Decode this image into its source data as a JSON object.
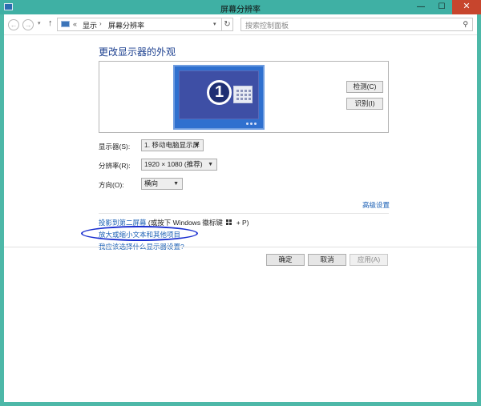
{
  "window": {
    "title": "屏幕分辨率",
    "minimize_glyph": "—",
    "maximize_glyph": "☐",
    "close_glyph": "✕"
  },
  "addressbar": {
    "back_glyph": "←",
    "forward_glyph": "→",
    "up_glyph": "↑",
    "breadcrumb_chevron": "«",
    "breadcrumb": [
      "显示",
      "屏幕分辨率"
    ],
    "breadcrumb_separator": "›",
    "search_placeholder": "搜索控制面板"
  },
  "main": {
    "title": "更改显示器的外观",
    "monitor_number": "1",
    "detect_label": "检测(C)",
    "identify_label": "识别(I)"
  },
  "settings": {
    "display": {
      "label": "显示器(S):",
      "value": "1. 移动电脑显示屏"
    },
    "resolution": {
      "label": "分辨率(R):",
      "value": "1920 × 1080 (推荐)"
    },
    "orientation": {
      "label": "方向(O):",
      "value": "横向"
    }
  },
  "links": {
    "advanced": "高级设置",
    "project_link": "投影到第二屏幕",
    "project_tail_pre": "(或按下 Windows 徽标键",
    "project_tail_post": "+ P)",
    "enlarge": "放大或缩小文本和其他项目",
    "which": "我应该选择什么显示器设置?"
  },
  "buttons": {
    "ok": "确定",
    "cancel": "取消",
    "apply": "应用(A)"
  },
  "icons": {
    "search": "search-icon",
    "refresh": "refresh-icon",
    "windows_logo": "windows-logo-icon"
  },
  "colors": {
    "titlebar": "#3fb0a4",
    "close": "#c7452d",
    "link": "#1a5fb4",
    "heading": "#1b3f8f",
    "monitor": "#2f70cf",
    "highlight_ellipse": "#1a2fd0"
  }
}
